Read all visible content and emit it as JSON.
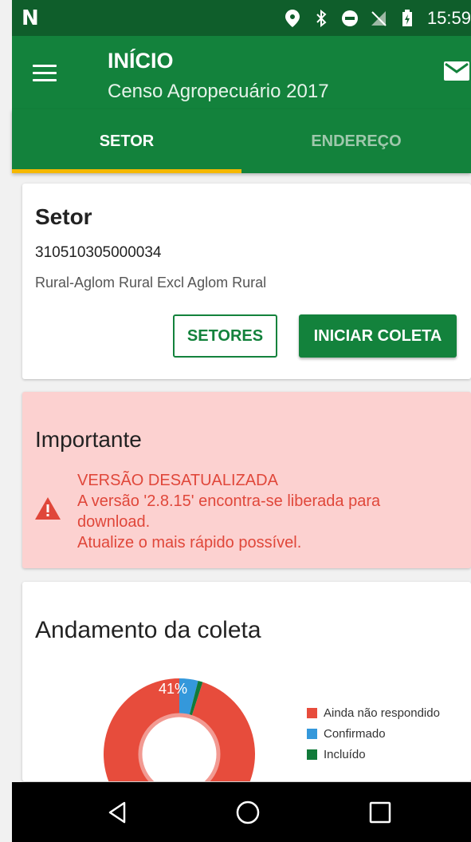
{
  "statusbar": {
    "time": "15:59",
    "icons": [
      "n-logo-icon",
      "location-icon",
      "bluetooth-icon",
      "do-not-disturb-icon",
      "no-signal-icon",
      "battery-icon"
    ]
  },
  "appbar": {
    "title": "INÍCIO",
    "subtitle": "Censo Agropecuário 2017"
  },
  "tabs": [
    {
      "label": "SETOR",
      "active": true
    },
    {
      "label": "ENDEREÇO",
      "active": false
    }
  ],
  "setor_card": {
    "title": "Setor",
    "code": "310510305000034",
    "description": "Rural-Aglom Rural Excl Aglom Rural",
    "btn_setores": "SETORES",
    "btn_iniciar": "INICIAR COLETA"
  },
  "important_card": {
    "title": "Importante",
    "line1": "VERSÃO DESATUALIZADA",
    "line2": "A versão '2.8.15' encontra-se liberada para",
    "line3": "download.",
    "line4": "Atualize o mais rápido possível."
  },
  "andamento_card": {
    "title": "Andamento da coleta"
  },
  "chart_data": {
    "type": "pie",
    "labels": [
      "Ainda não respondido",
      "Confirmado",
      "Incluído"
    ],
    "values": [
      0.95,
      0.04,
      0.01
    ],
    "colors": [
      "#e74c3c",
      "#3498db",
      "#117a3a"
    ],
    "annotation": "41%",
    "legend": "right"
  },
  "colors": {
    "primary": "#13823c",
    "statusbar": "#0f5e2b",
    "accent": "#f5b800",
    "warning_bg": "#fcd1d0",
    "warning_text": "#e0473a"
  }
}
